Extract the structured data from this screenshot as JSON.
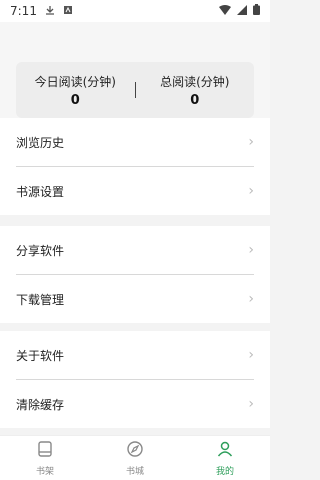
{
  "status_bar": {
    "time": "7:11"
  },
  "stats": {
    "today": {
      "label": "今日阅读(分钟)",
      "value": "0"
    },
    "total": {
      "label": "总阅读(分钟)",
      "value": "0"
    }
  },
  "menu": {
    "group1": [
      {
        "label": "浏览历史"
      },
      {
        "label": "书源设置"
      }
    ],
    "group2": [
      {
        "label": "分享软件"
      },
      {
        "label": "下载管理"
      }
    ],
    "group3": [
      {
        "label": "关于软件"
      },
      {
        "label": "清除缓存"
      }
    ],
    "chevron": "›"
  },
  "tabs": [
    {
      "label": "书架",
      "icon": "bookshelf-icon"
    },
    {
      "label": "书城",
      "icon": "compass-icon"
    },
    {
      "label": "我的",
      "icon": "user-icon"
    }
  ],
  "colors": {
    "accent": "#2e9e5b",
    "background": "#f3f3f3"
  }
}
